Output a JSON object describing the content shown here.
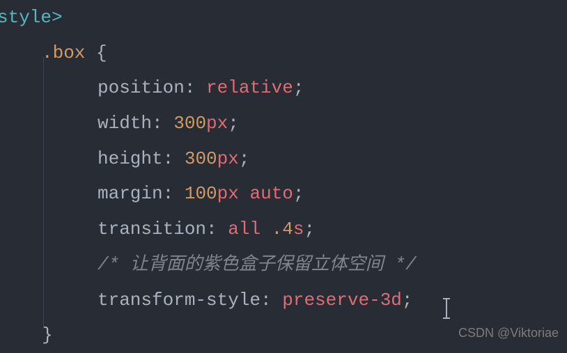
{
  "code": {
    "openTag": "style>",
    "selector": ".box",
    "openBrace": "{",
    "declarations": {
      "position": {
        "prop": "position",
        "value": "relative"
      },
      "width": {
        "prop": "width",
        "num": "300",
        "unit": "px"
      },
      "height": {
        "prop": "height",
        "num": "300",
        "unit": "px"
      },
      "margin": {
        "prop": "margin",
        "num": "100",
        "unit": "px",
        "value2": "auto"
      },
      "transition": {
        "prop": "transition",
        "value1": "all",
        "num": ".4",
        "unit": "s"
      },
      "comment": "/* 让背面的紫色盒子保留立体空间 */",
      "transformStyle": {
        "prop": "transform-style",
        "value": "preserve-3d"
      }
    },
    "closeBrace": "}"
  },
  "watermark": "CSDN @Viktoriae"
}
